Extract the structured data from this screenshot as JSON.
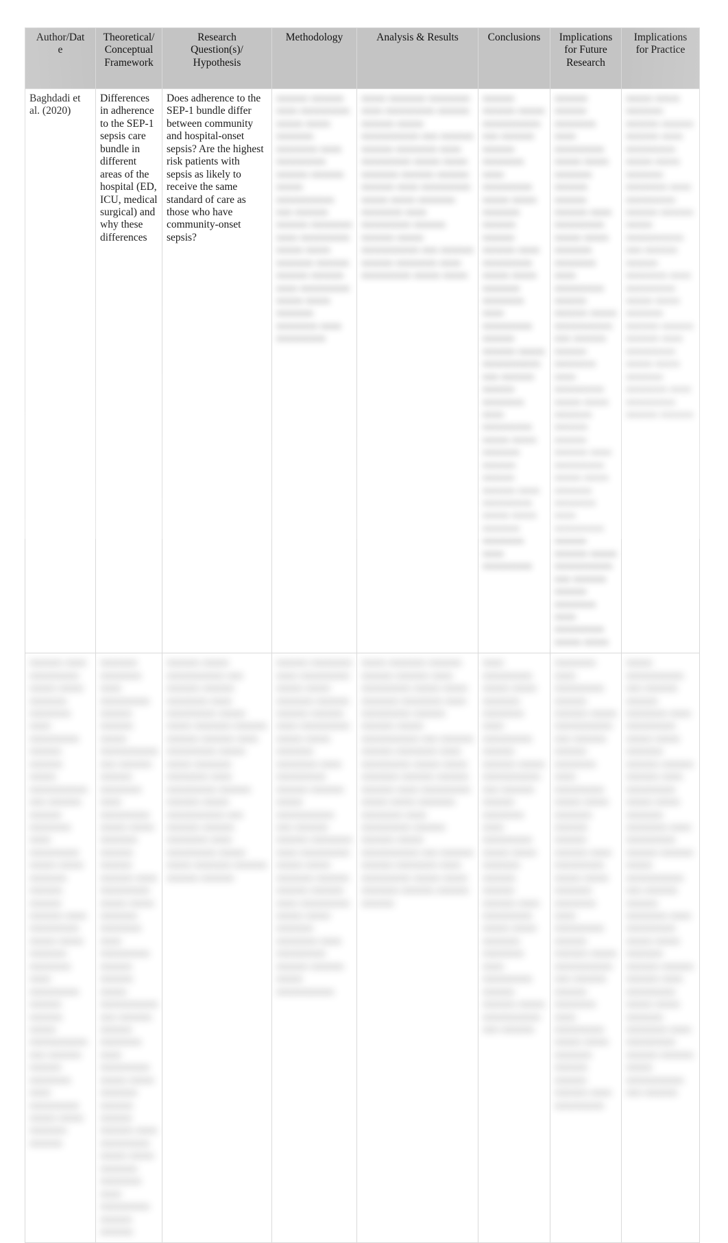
{
  "document": {
    "type": "literature-review-matrix-table",
    "background_color": "#ffffff",
    "header_background_color": "#c4c4c4",
    "text_color": "#1a1a1a",
    "border_color": "#dddddd"
  },
  "table": {
    "columns": [
      {
        "key": "author_date",
        "label": "Author/Date"
      },
      {
        "key": "framework",
        "label": "Theoretical/ Conceptual Framework"
      },
      {
        "key": "research_question",
        "label": "Research Question(s)/ Hypothesis"
      },
      {
        "key": "methodology",
        "label": "Methodology"
      },
      {
        "key": "analysis_results",
        "label": "Analysis & Results"
      },
      {
        "key": "conclusions",
        "label": "Conclusions"
      },
      {
        "key": "future_research",
        "label": "Implications for Future Research"
      },
      {
        "key": "practice",
        "label": "Implications for Practice"
      }
    ],
    "header_labels": {
      "author_date_line1": "Author/Dat",
      "author_date_line2": "e",
      "framework_line1": "Theoretical/",
      "framework_line2": "Conceptual",
      "framework_line3": "Framework",
      "research_question_line1": "Research",
      "research_question_line2": "Question(s)/",
      "research_question_line3": "Hypothesis",
      "methodology": "Methodology",
      "analysis_results": "Analysis & Results",
      "conclusions": "Conclusions",
      "future_research_line1": "Implications",
      "future_research_line2": "for Future",
      "future_research_line3": "Research",
      "practice_line1": "Implications",
      "practice_line2": "for Practice"
    },
    "rows": [
      {
        "id": "row-1",
        "author_date": "Baghdadi et al. (2020)",
        "framework": "Differences in adherence to the SEP-1 sepsis care bundle in different areas of the hospital (ED, ICU, medical surgical) and why these differences",
        "research_question": "Does adherence to the SEP-1 bundle differ between community and hospital-onset sepsis? Are the highest risk patients with sepsis as likely to receive the same standard of care as those who have community-onset sepsis?",
        "methodology": "",
        "analysis_results": "",
        "conclusions": "",
        "future_research": "",
        "practice": "",
        "redacted_cells": [
          "methodology",
          "analysis_results",
          "conclusions",
          "future_research",
          "practice"
        ]
      },
      {
        "id": "row-2",
        "author_date": "",
        "framework": "",
        "research_question": "",
        "methodology": "",
        "analysis_results": "",
        "conclusions": "",
        "future_research": "",
        "practice": "",
        "redacted_cells": [
          "author_date",
          "framework",
          "research_question",
          "methodology",
          "analysis_results",
          "conclusions",
          "future_research",
          "practice"
        ]
      }
    ]
  }
}
